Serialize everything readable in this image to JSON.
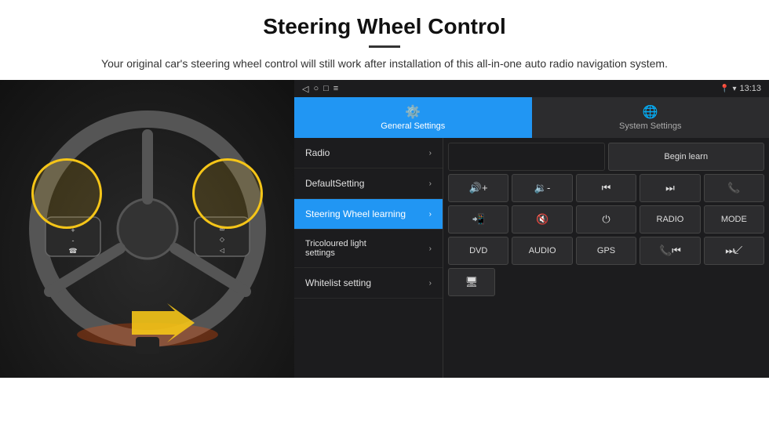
{
  "header": {
    "title": "Steering Wheel Control",
    "description": "Your original car's steering wheel control will still work after installation of this all-in-one auto radio navigation system."
  },
  "statusBar": {
    "time": "13:13",
    "leftIcons": [
      "◁",
      "○",
      "□",
      "≡"
    ]
  },
  "tabs": [
    {
      "id": "general",
      "label": "General Settings",
      "icon": "⚙",
      "active": true
    },
    {
      "id": "system",
      "label": "System Settings",
      "icon": "🌐",
      "active": false
    }
  ],
  "menuItems": [
    {
      "id": "radio",
      "label": "Radio",
      "active": false
    },
    {
      "id": "default",
      "label": "DefaultSetting",
      "active": false
    },
    {
      "id": "steering",
      "label": "Steering Wheel learning",
      "active": true
    },
    {
      "id": "tricoloured",
      "label": "Tricoloured light settings",
      "active": false
    },
    {
      "id": "whitelist",
      "label": "Whitelist setting",
      "active": false
    }
  ],
  "controls": {
    "beginLearnLabel": "Begin learn",
    "row1": [
      {
        "id": "vol-up",
        "icon": "🔊+",
        "text": ""
      },
      {
        "id": "vol-down",
        "icon": "🔉-",
        "text": ""
      },
      {
        "id": "prev",
        "icon": "⏮",
        "text": ""
      },
      {
        "id": "next",
        "icon": "⏭",
        "text": ""
      },
      {
        "id": "phone",
        "icon": "📞",
        "text": ""
      }
    ],
    "row2": [
      {
        "id": "answer",
        "icon": "📞",
        "text": ""
      },
      {
        "id": "mute",
        "icon": "🔇",
        "text": ""
      },
      {
        "id": "power",
        "icon": "⏻",
        "text": ""
      },
      {
        "id": "radio-btn",
        "icon": "",
        "text": "RADIO"
      },
      {
        "id": "mode-btn",
        "icon": "",
        "text": "MODE"
      }
    ],
    "row3": [
      {
        "id": "dvd",
        "icon": "",
        "text": "DVD"
      },
      {
        "id": "audio",
        "icon": "",
        "text": "AUDIO"
      },
      {
        "id": "gps",
        "icon": "",
        "text": "GPS"
      },
      {
        "id": "phone2",
        "icon": "📞⏮",
        "text": ""
      },
      {
        "id": "skip",
        "icon": "⏭",
        "text": ""
      }
    ],
    "row4": [
      {
        "id": "screen",
        "icon": "🖥",
        "text": ""
      }
    ]
  }
}
